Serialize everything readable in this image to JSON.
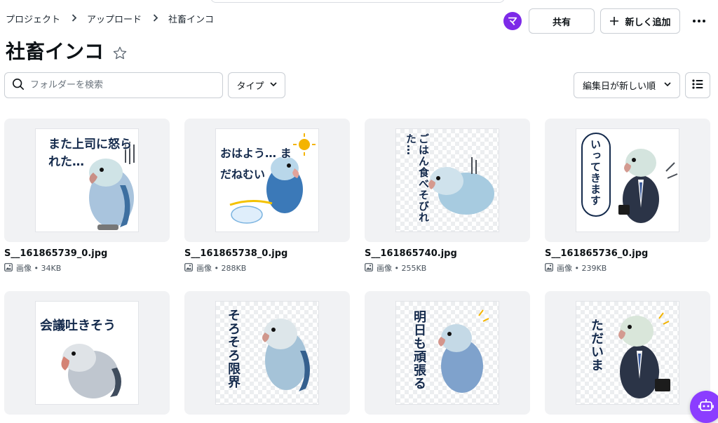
{
  "breadcrumb": [
    {
      "label": "プロジェクト"
    },
    {
      "label": "アップロード"
    },
    {
      "label": "社畜インコ"
    }
  ],
  "header": {
    "avatar_initial": "マ",
    "share_label": "共有",
    "new_label": "新しく追加",
    "accent_color": "#7d2ae8"
  },
  "page_title": "社畜インコ",
  "toolbar": {
    "search_placeholder": "フォルダーを検索",
    "type_label": "タイプ",
    "sort_label": "編集日が新しい順"
  },
  "files": [
    {
      "name": "S__161865739_0.jpg",
      "meta": "画像 • 34KB",
      "sticker": "また上司に怒られた…",
      "bg": "white"
    },
    {
      "name": "S__161865738_0.jpg",
      "meta": "画像 • 288KB",
      "sticker": "おはよう… まだねむい",
      "bg": "white"
    },
    {
      "name": "S__161865740.jpg",
      "meta": "画像 • 255KB",
      "sticker": "ごはん食べそびれた…",
      "bg": "checker"
    },
    {
      "name": "S__161865736_0.jpg",
      "meta": "画像 • 239KB",
      "sticker": "いってきます",
      "bg": "white"
    },
    {
      "name": "",
      "meta": "",
      "sticker": "会議吐きそう",
      "bg": "white"
    },
    {
      "name": "",
      "meta": "",
      "sticker": "そろそろ限界",
      "bg": "checker"
    },
    {
      "name": "",
      "meta": "",
      "sticker": "明日も頑張る",
      "bg": "checker"
    },
    {
      "name": "",
      "meta": "",
      "sticker": "ただいま",
      "bg": "checker"
    }
  ]
}
